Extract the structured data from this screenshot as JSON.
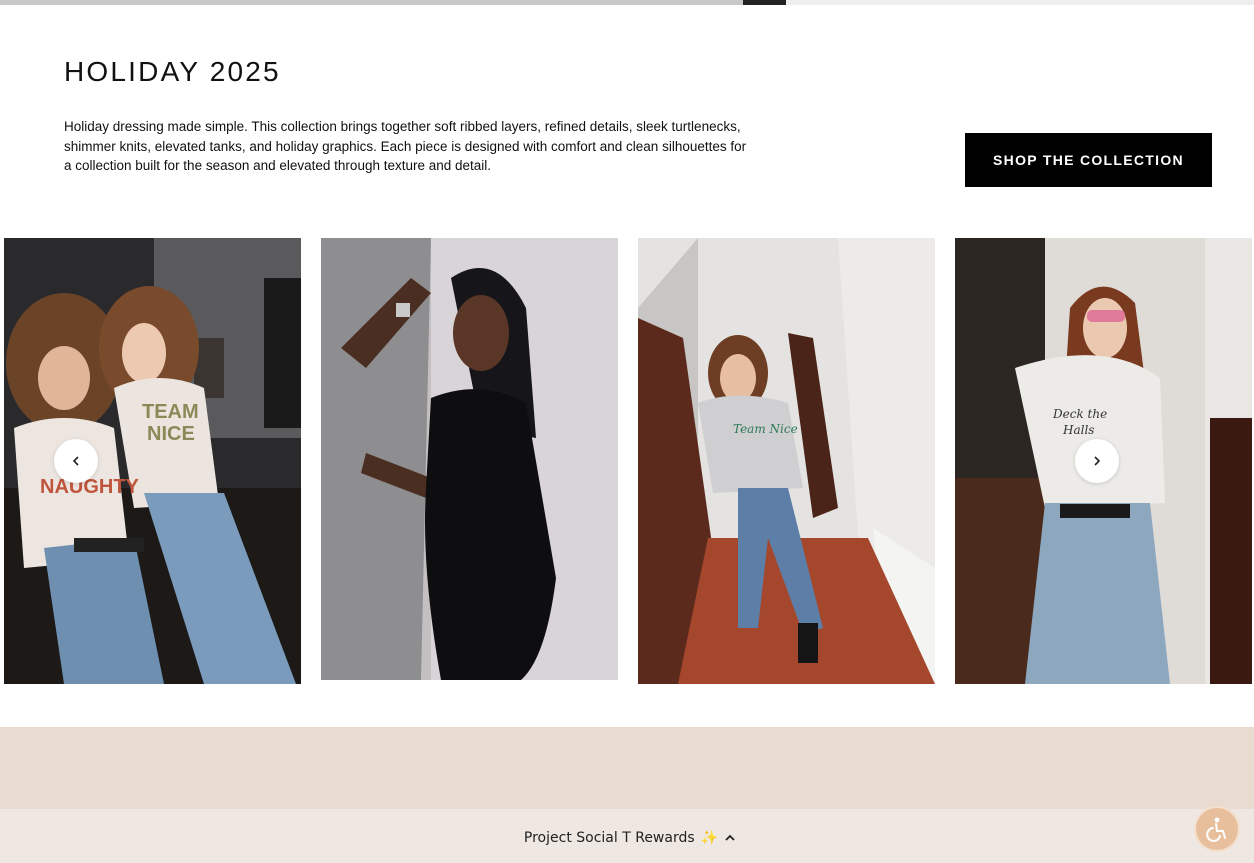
{
  "section": {
    "title": "HOLIDAY 2025",
    "description": "Holiday dressing made simple. This collection brings together soft ribbed layers, refined details, sleek turtlenecks, shimmer knits, elevated tanks, and holiday graphics. Each piece is designed with comfort and clean silhouettes for a collection built for the season and elevated through texture and detail.",
    "cta_label": "SHOP THE COLLECTION"
  },
  "carousel": {
    "prev_icon": "chevron-left-icon",
    "next_icon": "chevron-right-icon",
    "slides": [
      {
        "shirt_text": "TEAM NICE"
      },
      {
        "shirt_text": ""
      },
      {
        "shirt_text": "Team Nice"
      },
      {
        "shirt_text": "Deck the Halls"
      }
    ]
  },
  "footer": {
    "rewards_label": "Project Social T Rewards",
    "rewards_icon": "sparkle-icon",
    "toggle_icon": "chevron-up-icon",
    "accessibility_icon": "wheelchair-icon"
  },
  "colors": {
    "button_bg": "#000000",
    "promo_band": "#eadbd1",
    "rewards_bar": "#efe7e2",
    "accessibility": "#e8bf9c"
  }
}
